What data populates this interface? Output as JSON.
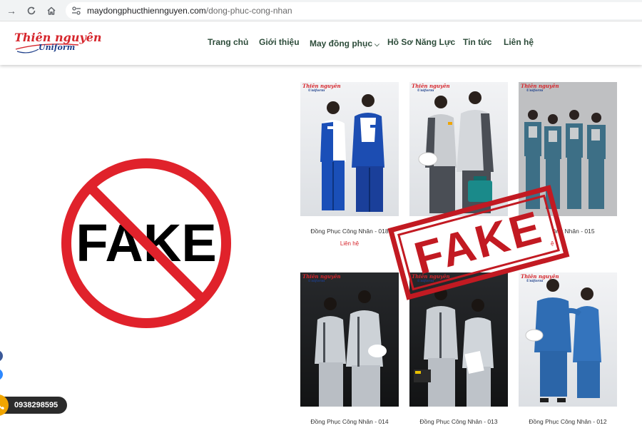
{
  "browser": {
    "url_domain": "maydongphucthiennguyen.com",
    "url_path": "/dong-phuc-cong-nhan"
  },
  "header": {
    "logo_main": "Thiên nguyên",
    "logo_sub": "Uniform",
    "menu": [
      {
        "label": "Trang chủ"
      },
      {
        "label": "Giới thiệu"
      },
      {
        "label": "May đồng phục"
      },
      {
        "label": "Hồ Sơ Năng Lực"
      },
      {
        "label": "Tin tức"
      },
      {
        "label": "Liên hệ"
      }
    ]
  },
  "products": [
    {
      "name": "Đồng Phục Công Nhân - 018",
      "price": "Liên hệ"
    },
    {
      "name": "",
      "price": ""
    },
    {
      "name": "ồng Nhân - 015",
      "price": "ệ"
    },
    {
      "name": "Đồng Phục Công Nhân - 014",
      "price": ""
    },
    {
      "name": "Đồng Phục Công Nhân - 013",
      "price": ""
    },
    {
      "name": "Đồng Phục Công Nhân - 012",
      "price": ""
    }
  ],
  "overlays": {
    "no_fake_text": "FAKE",
    "stamp_text": "FAKE",
    "stamp_color": "#c21a22",
    "no_sign_color": "#e0222b"
  },
  "floating": {
    "phone": "0938298595",
    "facebook_color": "#3b5998",
    "messenger_color": "#2d88ff",
    "phone_icon_color": "#f0a500"
  },
  "colors": {
    "brand_red": "#d6262c",
    "brand_blue": "#1e3f8a",
    "menu_text": "#2d4c3a"
  }
}
